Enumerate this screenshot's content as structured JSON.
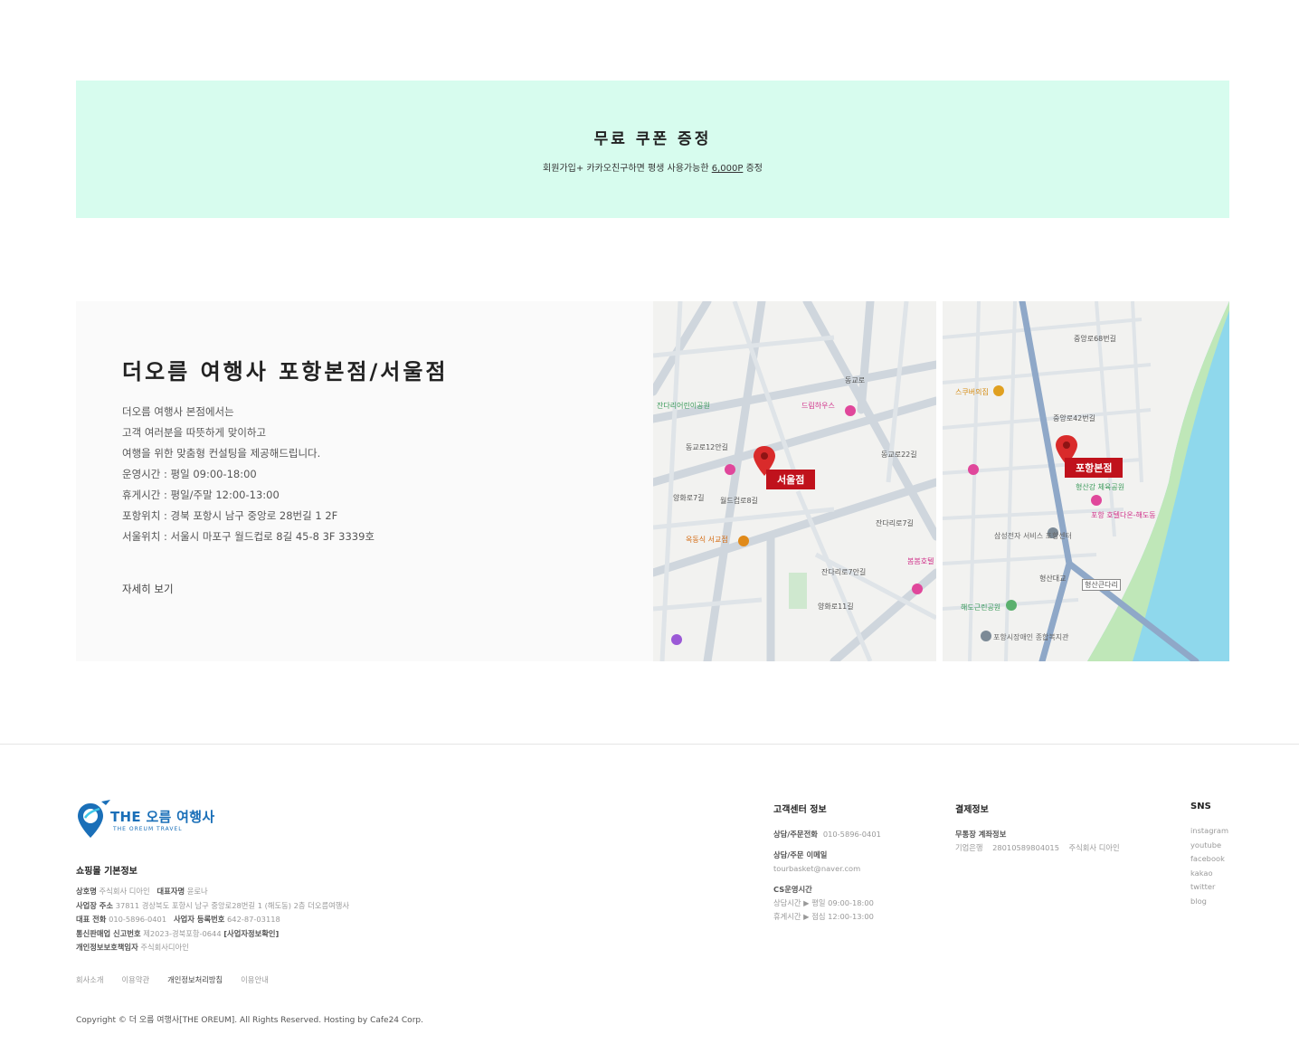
{
  "coupon": {
    "title": "무료 쿠폰 증정",
    "desc_prefix": "회원가입+ 카카오친구하면 평생 사용가능한",
    "amount": "6,000P",
    "desc_suffix": "증정"
  },
  "store": {
    "title": "더오름 여행사 포항본점/서울점",
    "lines": [
      "더오름 여행사 본점에서는",
      "고객 여러분을 따뜻하게 맞이하고",
      "여행을 위한 맞춤형 컨설팅을 제공해드립니다.",
      "운영시간 : 평일 09:00-18:00",
      "휴게시간 : 평일/주말 12:00-13:00",
      "포항위치 : 경북 포항시 남구 중앙로 28번길 1 2F",
      "서울위치 : 서울시 마포구 월드컵로 8길 45-8 3F 3339호"
    ],
    "more": "자세히 보기"
  },
  "maps": {
    "seoul": {
      "label": "서울점",
      "texts": [
        "잔다리어린이공원",
        "드림하우스",
        "동교로12안길",
        "양화로7길",
        "월드컵로8길",
        "옥동식 서교점",
        "잔다리로7길",
        "봄봄호텔",
        "양화로11길",
        "잔다리로7안길",
        "동교로22길",
        "동교로"
      ]
    },
    "pohang": {
      "label": "포항본점",
      "texts": [
        "스쿠버의집",
        "중앙로68번길",
        "중앙로42번길",
        "형산강 체육공원",
        "포항 호텔다온-해도동",
        "삼성전자 서비스 포항센터",
        "해도근린공원",
        "포항시장애인 종합복지관",
        "형산대교",
        "형산큰다리"
      ]
    }
  },
  "footer": {
    "logo": {
      "name": "THE 오름 여행사",
      "sub": "THE OREUM TRAVEL"
    },
    "shop_title": "쇼핑몰 기본정보",
    "shop_lines": [
      [
        {
          "k": "상호명",
          "v": "주식회사 디아인"
        },
        {
          "k": "대표자명",
          "v": "윤로나"
        }
      ],
      [
        {
          "k": "사업장 주소",
          "v": "37811 경상북도 포항시 남구 중앙로28번길 1 (해도동) 2층 더오름여행사"
        }
      ],
      [
        {
          "k": "대표 전화",
          "v": "010-5896-0401"
        },
        {
          "k": "사업자 등록번호",
          "v": "642-87-03118"
        }
      ],
      [
        {
          "k": "통신판매업 신고번호",
          "v": "제2023-경북포항-0644"
        },
        {
          "k": "[사업자정보확인]",
          "v": ""
        }
      ],
      [
        {
          "k": "개인정보보호책임자",
          "v": "주식회사디아인"
        }
      ]
    ],
    "links": [
      "회사소개",
      "이용약관",
      "개인정보처리방침",
      "이용안내"
    ],
    "copyright": "Copyright © 더 오름 여행사[THE OREUM]. All Rights Reserved. Hosting by Cafe24 Corp.",
    "cs": {
      "title": "고객센터 정보",
      "phone_label": "상담/주문전화",
      "phone": "010-5896-0401",
      "email_label": "상담/주문 이메일",
      "email": "tourbasket@naver.com",
      "hours_label": "CS운영시간",
      "hours1": "상담시간 ▶ 평일 09:00-18:00",
      "hours2": "휴게시간 ▶ 점심 12:00-13:00"
    },
    "pay": {
      "title": "결제정보",
      "bank_label": "무통장 계좌정보",
      "bank_info": "기업은행    28010589804015    주식회사 디아인"
    },
    "sns": {
      "title": "SNS",
      "items": [
        "instagram",
        "youtube",
        "facebook",
        "kakao",
        "twitter",
        "blog"
      ]
    }
  },
  "colors": {
    "coupon_bg": "#d7fcee",
    "map_label": "#c0121c",
    "river": "#8fd8ec",
    "logo_blue": "#1a6fb8"
  }
}
